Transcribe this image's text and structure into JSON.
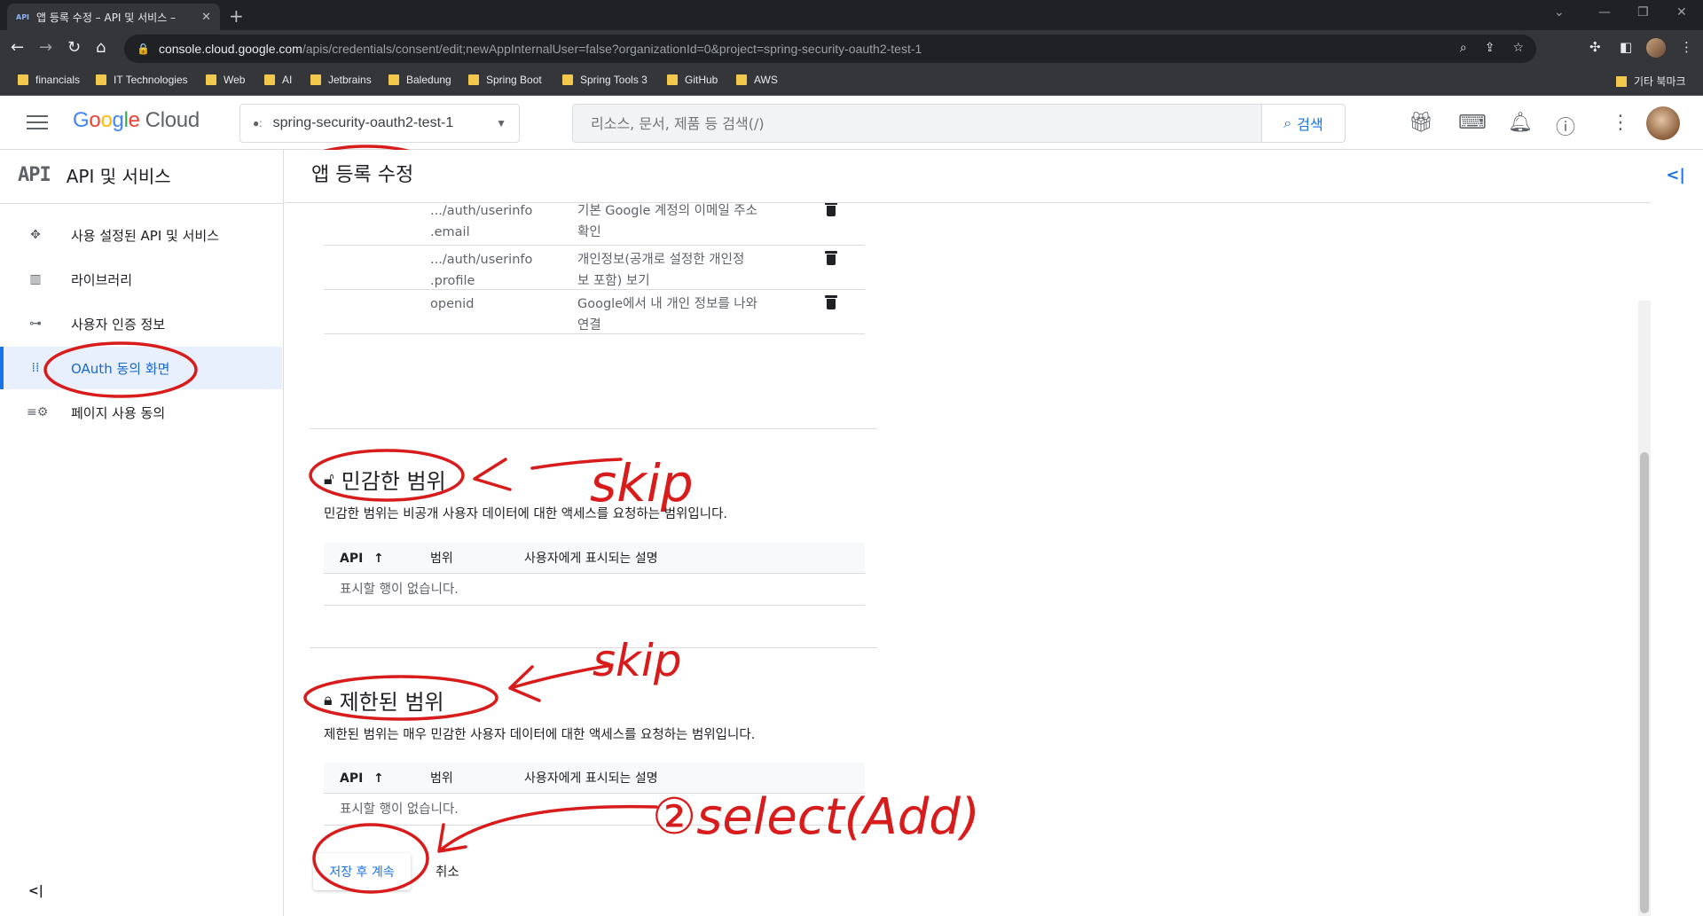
{
  "browser": {
    "tab_title": "앱 등록 수정 – API 및 서비스 –",
    "tab_favicon": "API",
    "url_host": "console.cloud.google.com",
    "url_path": "/apis/credentials/consent/edit;newAppInternalUser=false?organizationId=0&project=spring-security-oauth2-test-1",
    "bookmarks": [
      "financials",
      "IT Technologies",
      "Web",
      "AI",
      "Jetbrains",
      "Baledung",
      "Spring Boot",
      "Spring Tools 3",
      "GitHub",
      "AWS"
    ],
    "other_bookmarks": "기타 북마크"
  },
  "header": {
    "logo_cloud": "Cloud",
    "project": "spring-security-oauth2-test-1",
    "search_placeholder": "리소스, 문서, 제품 등 검색(/)",
    "search_button": "검색"
  },
  "sidebar": {
    "section_mark": "API",
    "title": "API 및 서비스",
    "items": [
      {
        "label": "사용 설정된 API 및 서비스",
        "icon": "apis-icon"
      },
      {
        "label": "라이브러리",
        "icon": "library-icon"
      },
      {
        "label": "사용자 인증 정보",
        "icon": "key-icon"
      },
      {
        "label": "OAuth 동의 화면",
        "icon": "consent-icon"
      },
      {
        "label": "페이지 사용 동의",
        "icon": "settings-list-icon"
      }
    ]
  },
  "main": {
    "page_title": "앱 등록 수정",
    "columns": {
      "api": "API",
      "scope": "범위",
      "desc": "사용자에게 표시되는 설명"
    },
    "nonsensitive_rows": [
      {
        "scope_l1": ".../auth/userinfo",
        "scope_l2": ".email",
        "desc_l1": "기본 Google 계정의 이메일 주소",
        "desc_l2": "확인"
      },
      {
        "scope_l1": ".../auth/userinfo",
        "scope_l2": ".profile",
        "desc_l1": "개인정보(공개로 설정한 개인정",
        "desc_l2": "보 포함) 보기"
      },
      {
        "scope_l1": "openid",
        "scope_l2": "",
        "desc_l1": "Google에서 내 개인 정보를 나와",
        "desc_l2": "연결"
      }
    ],
    "sensitive": {
      "title": "민감한 범위",
      "desc": "민감한 범위는 비공개 사용자 데이터에 대한 액세스를 요청하는 범위입니다.",
      "empty": "표시할 행이 없습니다."
    },
    "restricted": {
      "title": "제한된 범위",
      "desc": "제한된 범위는 매우 민감한 사용자 데이터에 대한 액세스를 요청하는 범위입니다.",
      "empty": "표시할 행이 없습니다."
    },
    "save_button": "저장 후 계속",
    "cancel_button": "취소"
  },
  "annotations": {
    "note_sensitive": "skip",
    "note_restricted": "skip",
    "note_save": "②select(Add)",
    "ink_color": "#d81b1b"
  }
}
